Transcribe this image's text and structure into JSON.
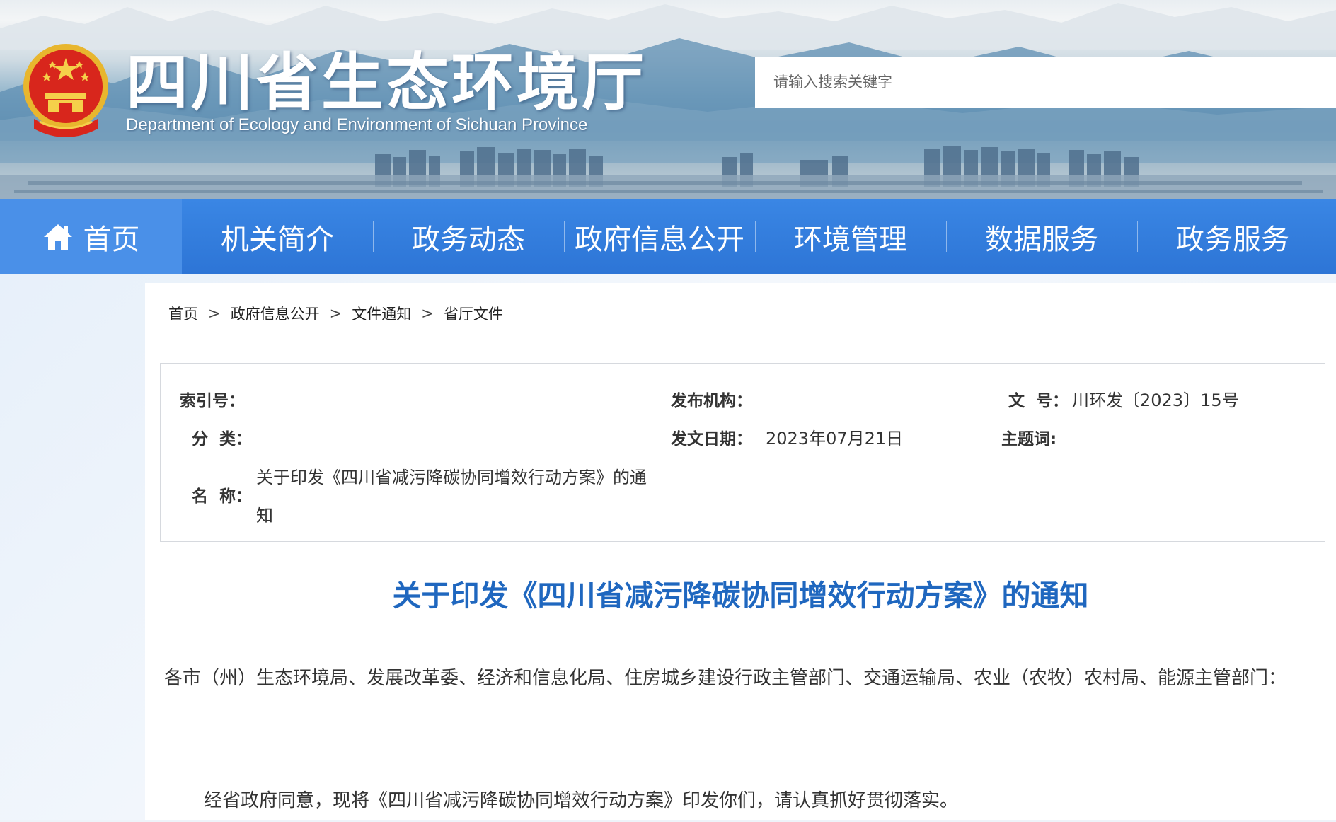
{
  "header": {
    "title": "四川省生态环境厅",
    "subtitle": "Department of Ecology and Environment of Sichuan Province",
    "search_placeholder": "请输入搜索关键字"
  },
  "nav": {
    "items": [
      {
        "label": "首页",
        "icon": "home-icon",
        "active": true
      },
      {
        "label": "机关简介"
      },
      {
        "label": "政务动态"
      },
      {
        "label": "政府信息公开"
      },
      {
        "label": "环境管理"
      },
      {
        "label": "数据服务"
      },
      {
        "label": "政务服务"
      }
    ]
  },
  "breadcrumb": {
    "items": [
      "首页",
      "政府信息公开",
      "文件通知",
      "省厅文件"
    ],
    "separator": ">"
  },
  "info": {
    "index_label": "索引号：",
    "index_value": "",
    "publisher_label": "发布机构：",
    "publisher_value": "",
    "doc_no_label": "文  号：",
    "doc_no_value": "川环发〔2023〕15号",
    "category_label": "分  类：",
    "category_value": "",
    "date_label": "发文日期：",
    "date_value": "2023年07月21日",
    "subject_label": "主题词:",
    "subject_value": "",
    "name_label": "名  称：",
    "name_value": "关于印发《四川省减污降碳协同增效行动方案》的通知"
  },
  "document": {
    "title": "关于印发《四川省减污降碳协同增效行动方案》的通知",
    "salutation": "各市（州）生态环境局、发展改革委、经济和信息化局、住房城乡建设行政主管部门、交通运输局、农业（农牧）农村局、能源主管部门：",
    "paragraph1": "经省政府同意，现将《四川省减污降碳协同增效行动方案》印发你们，请认真抓好贯彻落实。"
  },
  "colors": {
    "nav_bg": "#2d75d6",
    "nav_active": "#4a90e8",
    "title_blue": "#1f67bf",
    "emblem_red": "#d8261c",
    "emblem_gold": "#f0c030"
  }
}
